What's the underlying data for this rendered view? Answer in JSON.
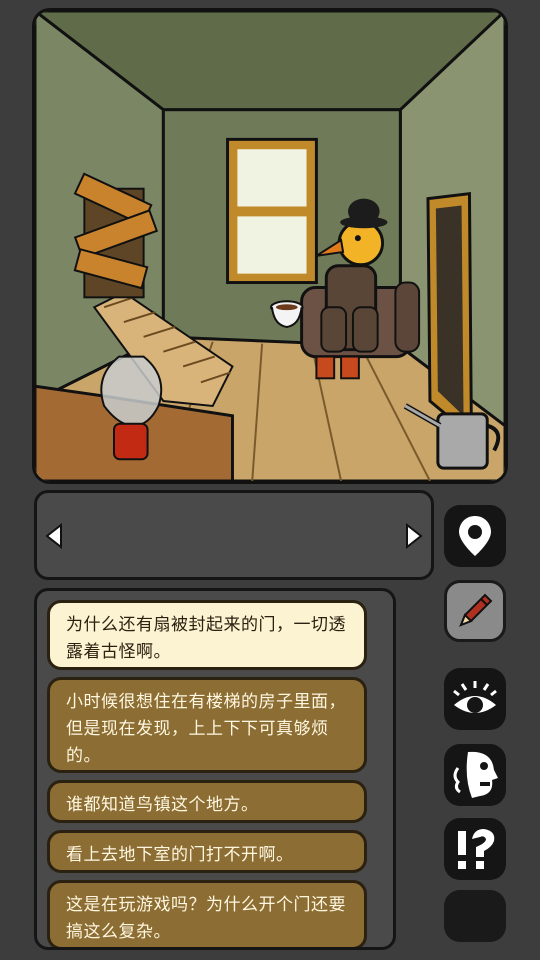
{
  "scene": {
    "description_icons": [
      "oil-lamp",
      "teacup",
      "watering-can",
      "boarded-door",
      "staircase",
      "window",
      "bird-man-in-bowler-hat",
      "armchair",
      "doorway"
    ]
  },
  "item_bar": {
    "left_arrow": "chevron-left-icon",
    "right_arrow": "chevron-right-icon"
  },
  "dialog": {
    "options": [
      "为什么还有扇被封起来的门，一切透露着古怪啊。",
      "小时候很想住在有楼梯的房子里面，但是现在发现，上上下下可真够烦的。",
      "谁都知道鸟镇这个地方。",
      "看上去地下室的门打不开啊。",
      "这是在玩游戏吗？为什么开个门还要搞这么复杂。"
    ],
    "selected_index": 0
  },
  "side_buttons": {
    "icons": [
      "location-pin-icon",
      "pencil-icon",
      "eye-icon",
      "face-profile-icon",
      "exclamation-question-icon",
      "blank-icon"
    ]
  },
  "colors": {
    "background": "#3d3d3d",
    "option_fill": "#8c6d33",
    "option_selected_fill": "#fbf3d2",
    "wall_green": "#6e7a57"
  }
}
